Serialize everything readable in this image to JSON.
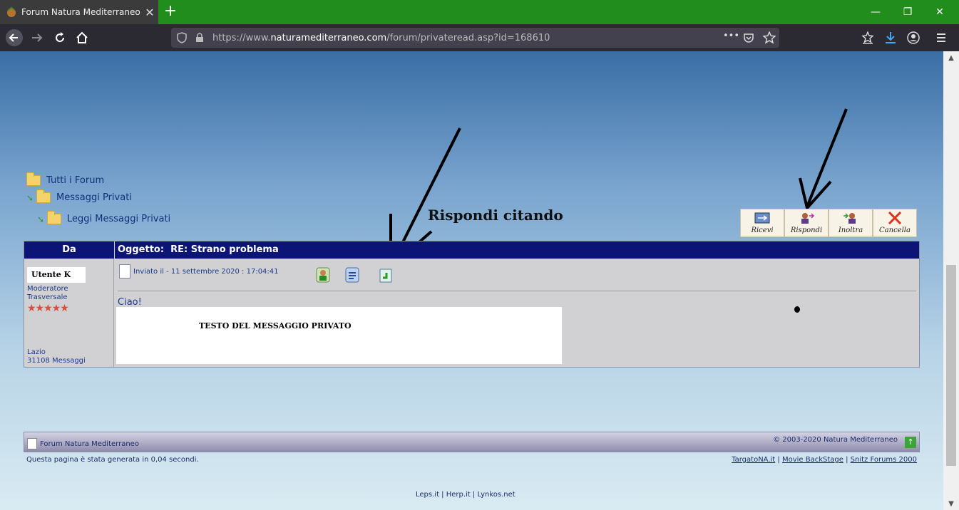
{
  "browser": {
    "tab_title": "Forum Natura Mediterraneo | F",
    "url_prefix": "https://www.",
    "url_domain": "naturamediterraneo.com",
    "url_path": "/forum/privateread.asp?id=168610",
    "url_more": "•••"
  },
  "breadcrumb": {
    "all_forums": "Tutti i Forum",
    "private_messages": "Messaggi Privati",
    "read_private": "Leggi Messaggi Privati"
  },
  "annotation": "Rispondi citando",
  "toolbar": {
    "receive": "Ricevi",
    "reply": "Rispondi",
    "forward": "Inoltra",
    "delete": "Cancella"
  },
  "message": {
    "col_from": "Da",
    "subject_label": "Oggetto:",
    "subject": "RE: Strano problema",
    "author": "Utente K",
    "role_line1": "Moderatore",
    "role_line2": "Trasversale",
    "stars": "★★★★★",
    "location": "Lazio",
    "post_count": "31108 Messaggi",
    "sent_info": "Inviato il - 11 settembre 2020 :  17:04:41",
    "greeting": "Ciao!",
    "body": "TESTO DEL MESSAGGIO PRIVATO"
  },
  "footer": {
    "site_name": "Forum Natura Mediterraneo",
    "copyright": "© 2003-2020 Natura Mediterraneo",
    "generated": "Questa pagina è stata generata in 0,04 secondi.",
    "link1": "TargatoNA.it",
    "link2": "Movie BackStage",
    "link3": "Snitz Forums 2000",
    "bottom": "Leps.it | Herp.it | Lynkos.net"
  },
  "colors": {
    "header_navy": "#0c1476",
    "tabbar_green": "#218d1c",
    "link_blue": "#12307a"
  }
}
